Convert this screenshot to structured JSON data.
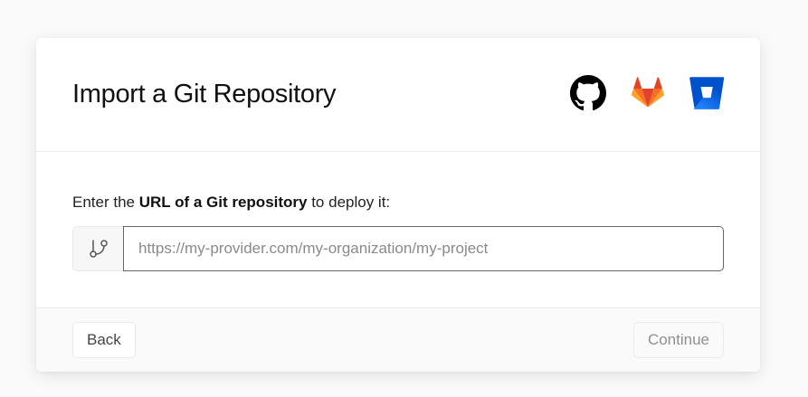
{
  "dialog": {
    "title": "Import a Git Repository",
    "providers": [
      {
        "name": "GitHub",
        "icon": "github-icon",
        "color": "#000000"
      },
      {
        "name": "GitLab",
        "icon": "gitlab-icon",
        "color": "#E24329"
      },
      {
        "name": "Bitbucket",
        "icon": "bitbucket-icon",
        "color": "#0052CC"
      }
    ]
  },
  "body": {
    "prompt_prefix": "Enter the ",
    "prompt_bold": "URL of a Git repository",
    "prompt_suffix": " to deploy it:",
    "input_icon": "git-branch-icon",
    "url_input": {
      "value": "",
      "placeholder": "https://my-provider.com/my-organization/my-project"
    }
  },
  "footer": {
    "back_label": "Back",
    "continue_label": "Continue"
  }
}
